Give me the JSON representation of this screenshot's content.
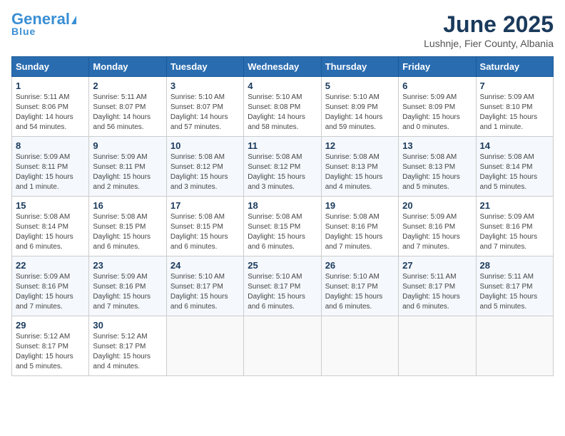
{
  "header": {
    "logo_general": "General",
    "logo_blue": "Blue",
    "month_title": "June 2025",
    "subtitle": "Lushnje, Fier County, Albania"
  },
  "weekdays": [
    "Sunday",
    "Monday",
    "Tuesday",
    "Wednesday",
    "Thursday",
    "Friday",
    "Saturday"
  ],
  "weeks": [
    [
      {
        "day": "1",
        "sunrise": "5:11 AM",
        "sunset": "8:06 PM",
        "daylight": "14 hours and 54 minutes."
      },
      {
        "day": "2",
        "sunrise": "5:11 AM",
        "sunset": "8:07 PM",
        "daylight": "14 hours and 56 minutes."
      },
      {
        "day": "3",
        "sunrise": "5:10 AM",
        "sunset": "8:07 PM",
        "daylight": "14 hours and 57 minutes."
      },
      {
        "day": "4",
        "sunrise": "5:10 AM",
        "sunset": "8:08 PM",
        "daylight": "14 hours and 58 minutes."
      },
      {
        "day": "5",
        "sunrise": "5:10 AM",
        "sunset": "8:09 PM",
        "daylight": "14 hours and 59 minutes."
      },
      {
        "day": "6",
        "sunrise": "5:09 AM",
        "sunset": "8:09 PM",
        "daylight": "15 hours and 0 minutes."
      },
      {
        "day": "7",
        "sunrise": "5:09 AM",
        "sunset": "8:10 PM",
        "daylight": "15 hours and 1 minute."
      }
    ],
    [
      {
        "day": "8",
        "sunrise": "5:09 AM",
        "sunset": "8:11 PM",
        "daylight": "15 hours and 1 minute."
      },
      {
        "day": "9",
        "sunrise": "5:09 AM",
        "sunset": "8:11 PM",
        "daylight": "15 hours and 2 minutes."
      },
      {
        "day": "10",
        "sunrise": "5:08 AM",
        "sunset": "8:12 PM",
        "daylight": "15 hours and 3 minutes."
      },
      {
        "day": "11",
        "sunrise": "5:08 AM",
        "sunset": "8:12 PM",
        "daylight": "15 hours and 3 minutes."
      },
      {
        "day": "12",
        "sunrise": "5:08 AM",
        "sunset": "8:13 PM",
        "daylight": "15 hours and 4 minutes."
      },
      {
        "day": "13",
        "sunrise": "5:08 AM",
        "sunset": "8:13 PM",
        "daylight": "15 hours and 5 minutes."
      },
      {
        "day": "14",
        "sunrise": "5:08 AM",
        "sunset": "8:14 PM",
        "daylight": "15 hours and 5 minutes."
      }
    ],
    [
      {
        "day": "15",
        "sunrise": "5:08 AM",
        "sunset": "8:14 PM",
        "daylight": "15 hours and 6 minutes."
      },
      {
        "day": "16",
        "sunrise": "5:08 AM",
        "sunset": "8:15 PM",
        "daylight": "15 hours and 6 minutes."
      },
      {
        "day": "17",
        "sunrise": "5:08 AM",
        "sunset": "8:15 PM",
        "daylight": "15 hours and 6 minutes."
      },
      {
        "day": "18",
        "sunrise": "5:08 AM",
        "sunset": "8:15 PM",
        "daylight": "15 hours and 6 minutes."
      },
      {
        "day": "19",
        "sunrise": "5:08 AM",
        "sunset": "8:16 PM",
        "daylight": "15 hours and 7 minutes."
      },
      {
        "day": "20",
        "sunrise": "5:09 AM",
        "sunset": "8:16 PM",
        "daylight": "15 hours and 7 minutes."
      },
      {
        "day": "21",
        "sunrise": "5:09 AM",
        "sunset": "8:16 PM",
        "daylight": "15 hours and 7 minutes."
      }
    ],
    [
      {
        "day": "22",
        "sunrise": "5:09 AM",
        "sunset": "8:16 PM",
        "daylight": "15 hours and 7 minutes."
      },
      {
        "day": "23",
        "sunrise": "5:09 AM",
        "sunset": "8:16 PM",
        "daylight": "15 hours and 7 minutes."
      },
      {
        "day": "24",
        "sunrise": "5:10 AM",
        "sunset": "8:17 PM",
        "daylight": "15 hours and 6 minutes."
      },
      {
        "day": "25",
        "sunrise": "5:10 AM",
        "sunset": "8:17 PM",
        "daylight": "15 hours and 6 minutes."
      },
      {
        "day": "26",
        "sunrise": "5:10 AM",
        "sunset": "8:17 PM",
        "daylight": "15 hours and 6 minutes."
      },
      {
        "day": "27",
        "sunrise": "5:11 AM",
        "sunset": "8:17 PM",
        "daylight": "15 hours and 6 minutes."
      },
      {
        "day": "28",
        "sunrise": "5:11 AM",
        "sunset": "8:17 PM",
        "daylight": "15 hours and 5 minutes."
      }
    ],
    [
      {
        "day": "29",
        "sunrise": "5:12 AM",
        "sunset": "8:17 PM",
        "daylight": "15 hours and 5 minutes."
      },
      {
        "day": "30",
        "sunrise": "5:12 AM",
        "sunset": "8:17 PM",
        "daylight": "15 hours and 4 minutes."
      },
      null,
      null,
      null,
      null,
      null
    ]
  ]
}
